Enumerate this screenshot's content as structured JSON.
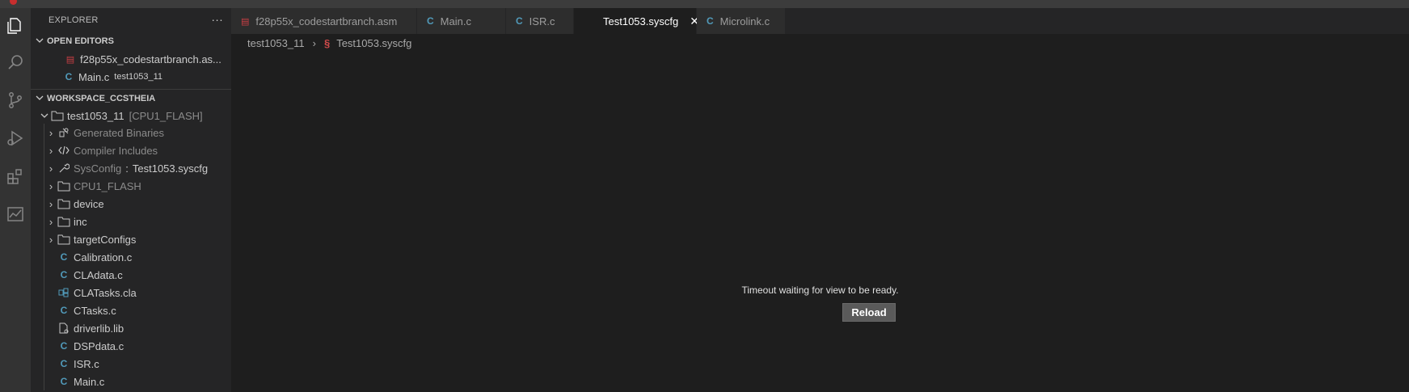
{
  "sidebar": {
    "title": "EXPLORER",
    "more": "···",
    "open_editors": {
      "header": "OPEN EDITORS",
      "items": [
        {
          "name": "f28p55x_codestartbranch.as...",
          "desc": ""
        },
        {
          "name": "Main.c",
          "desc": "test1053_11"
        }
      ]
    },
    "workspace": {
      "header": "WORKSPACE_CCSTHEIA",
      "project": {
        "name": "test1053_11",
        "desc": "[CPU1_FLASH]"
      },
      "items": [
        {
          "name": "Generated Binaries"
        },
        {
          "name": "Compiler Includes"
        },
        {
          "name": "SysConfig",
          "sep": ":",
          "value": "Test1053.syscfg"
        },
        {
          "name": "CPU1_FLASH"
        },
        {
          "name": "device"
        },
        {
          "name": "inc"
        },
        {
          "name": "targetConfigs"
        },
        {
          "name": "Calibration.c"
        },
        {
          "name": "CLAdata.c"
        },
        {
          "name": "CLATasks.cla"
        },
        {
          "name": "CTasks.c"
        },
        {
          "name": "driverlib.lib"
        },
        {
          "name": "DSPdata.c"
        },
        {
          "name": "ISR.c"
        },
        {
          "name": "Main.c"
        }
      ]
    }
  },
  "tabs": [
    {
      "label": "f28p55x_codestartbranch.asm"
    },
    {
      "label": "Main.c"
    },
    {
      "label": "ISR.c"
    },
    {
      "label": "Test1053.syscfg",
      "close": "✕"
    },
    {
      "label": "Microlink.c"
    }
  ],
  "breadcrumb": {
    "project": "test1053_11",
    "separator": "›",
    "file_icon": "§",
    "file": "Test1053.syscfg"
  },
  "editor": {
    "message": "Timeout waiting for view to be ready.",
    "reload_label": "Reload"
  },
  "icons": {
    "c_file": "C",
    "chevron_right": "›"
  },
  "colors": {
    "c_icon": "#519aba",
    "asm_icon": "#cc3e44",
    "syscfg_icon": "#d14b4b"
  }
}
